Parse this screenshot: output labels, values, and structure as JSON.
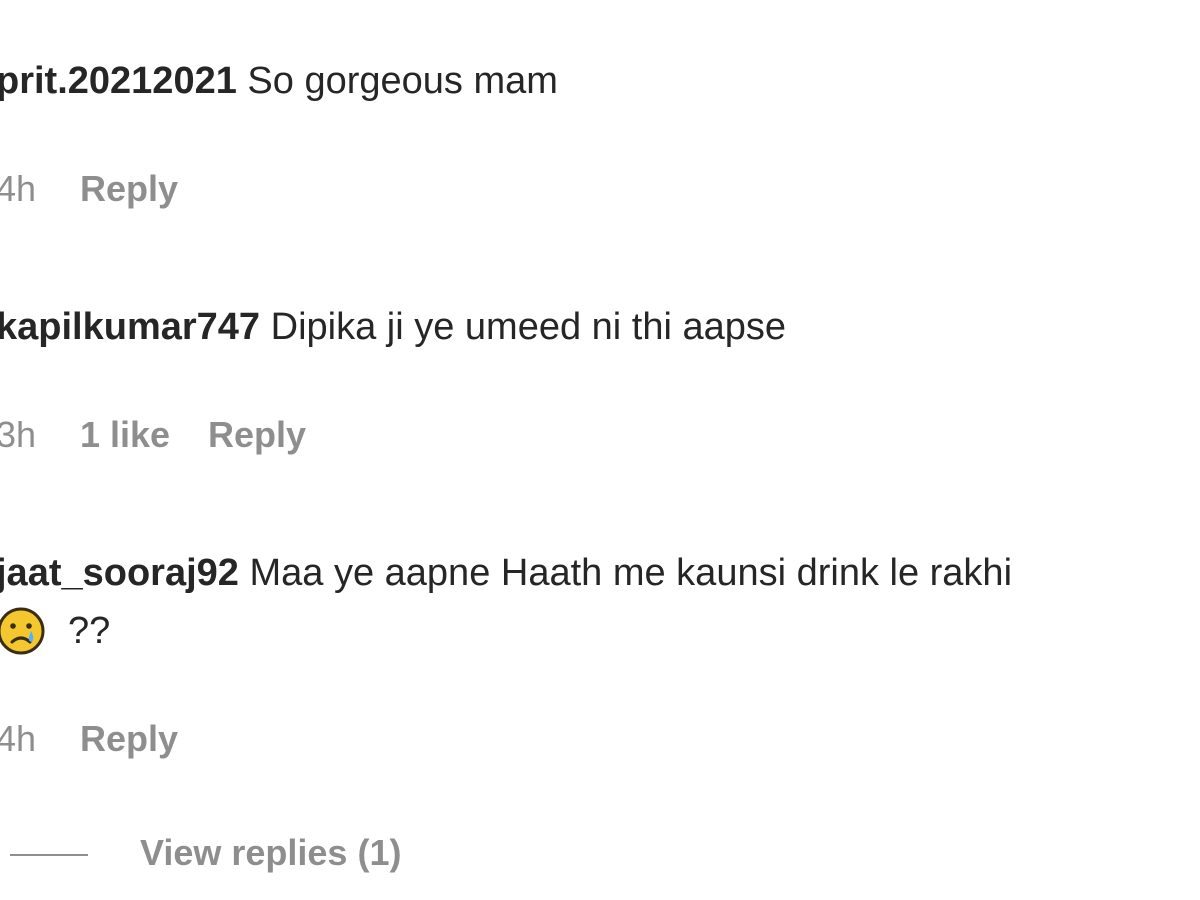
{
  "comments": [
    {
      "username": "prit.20212021",
      "text": "So gorgeous mam",
      "time": "4h",
      "likes": "",
      "reply_label": "Reply"
    },
    {
      "username": "kapilkumar747",
      "text": "Dipika ji ye umeed ni thi aapse",
      "time": "3h",
      "likes": "1 like",
      "reply_label": "Reply"
    },
    {
      "username": "jaat_sooraj92",
      "text": "Maa ye aapne Haath me kaunsi drink le rakhi",
      "text_line2": "??",
      "emoji": "crying-face-icon",
      "time": "4h",
      "likes": "",
      "reply_label": "Reply"
    }
  ],
  "view_replies_label": "View replies (1)",
  "colors": {
    "text": "#262626",
    "secondary": "#8e8e8e",
    "emoji_face": "#f5c72e",
    "emoji_outline": "#3a2e12",
    "emoji_tear": "#4fb3ff"
  }
}
